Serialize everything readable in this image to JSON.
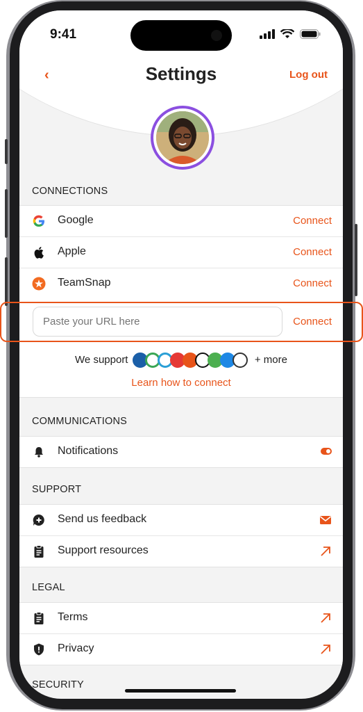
{
  "status": {
    "time": "9:41"
  },
  "header": {
    "back": "‹",
    "title": "Settings",
    "logout": "Log out"
  },
  "connections": {
    "title": "CONNECTIONS",
    "items": [
      {
        "label": "Google",
        "action": "Connect",
        "icon": "google-icon"
      },
      {
        "label": "Apple",
        "action": "Connect",
        "icon": "apple-icon"
      },
      {
        "label": "TeamSnap",
        "action": "Connect",
        "icon": "teamsnap-icon"
      }
    ],
    "url_placeholder": "Paste your URL here",
    "url_action": "Connect",
    "support_prefix": "We support",
    "support_suffix": "+ more",
    "learn": "Learn how to connect"
  },
  "communications": {
    "title": "COMMUNICATIONS",
    "items": [
      {
        "label": "Notifications",
        "icon": "bell-icon"
      }
    ]
  },
  "support": {
    "title": "SUPPORT",
    "items": [
      {
        "label": "Send us feedback",
        "icon": "feedback-icon"
      },
      {
        "label": "Support resources",
        "icon": "clipboard-icon"
      }
    ]
  },
  "legal": {
    "title": "LEGAL",
    "items": [
      {
        "label": "Terms",
        "icon": "clipboard-icon"
      },
      {
        "label": "Privacy",
        "icon": "shield-icon"
      }
    ]
  },
  "security": {
    "title": "SECURITY"
  },
  "colors": {
    "accent": "#e8541a",
    "avatar_ring": "#8b4fe0"
  }
}
